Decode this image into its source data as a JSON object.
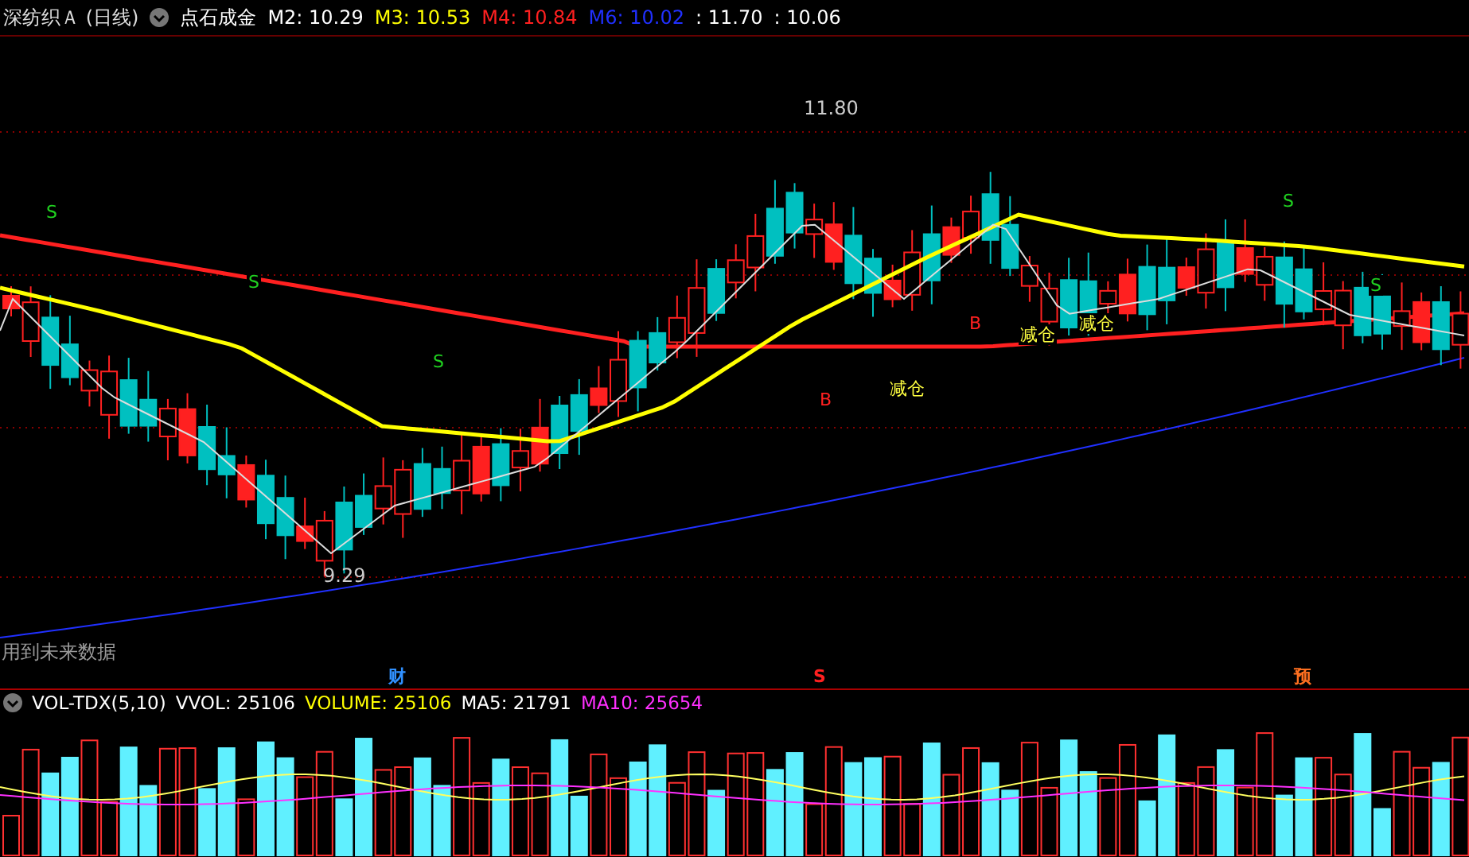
{
  "header": {
    "title": "深纺织Ａ (日线)",
    "indicator": "点石成金",
    "readings": [
      {
        "text": "M2: 10.29",
        "color": "#ffffff"
      },
      {
        "text": "M3: 10.53",
        "color": "#ffff00"
      },
      {
        "text": "M4: 10.84",
        "color": "#ff2020"
      },
      {
        "text": "M6: 10.02",
        "color": "#2030ff"
      },
      {
        "text": ": 11.70",
        "color": "#ffffff"
      },
      {
        "text": ": 10.06",
        "color": "#ffffff"
      }
    ]
  },
  "price_chart": {
    "high_label": "11.80",
    "low_label": "9.29",
    "notice": "用到未来数据",
    "markers": [
      {
        "kind": "sell",
        "text": "S"
      },
      {
        "kind": "sell",
        "text": "S"
      },
      {
        "kind": "sell",
        "text": "S"
      },
      {
        "kind": "buy",
        "text": "B"
      },
      {
        "kind": "reduce",
        "text": "减仓"
      },
      {
        "kind": "buy",
        "text": "B"
      },
      {
        "kind": "reduce",
        "text": "减仓"
      },
      {
        "kind": "reduce",
        "text": "减仓"
      },
      {
        "kind": "sell",
        "text": "S"
      },
      {
        "kind": "sell",
        "text": "S"
      }
    ]
  },
  "events": [
    {
      "text": "财",
      "color": "#3090ff"
    },
    {
      "text": "S",
      "color": "#ff2020"
    },
    {
      "text": "预",
      "color": "#ff7020"
    }
  ],
  "volume_header": {
    "name": "VOL-TDX(5,10)",
    "readings": [
      {
        "text": "VVOL: 25106",
        "color": "#ffffff"
      },
      {
        "text": "VOLUME: 25106",
        "color": "#ffff00"
      },
      {
        "text": "MA5: 21791",
        "color": "#ffffff"
      },
      {
        "text": "MA10: 25654",
        "color": "#ff30ff"
      }
    ]
  }
}
